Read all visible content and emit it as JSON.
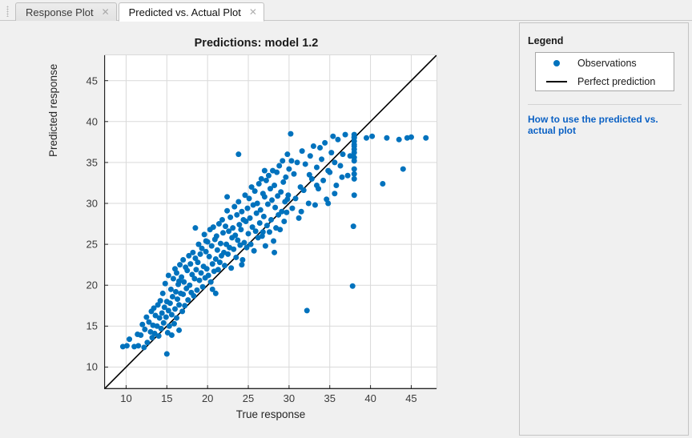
{
  "tabs": [
    {
      "label": "Response Plot",
      "close": "✕",
      "active": false
    },
    {
      "label": "Predicted vs. Actual Plot",
      "close": "✕",
      "active": true
    }
  ],
  "grip_icon": "drag-grip-icon",
  "panel": {
    "heading": "Legend",
    "legend_items": [
      {
        "label": "Observations",
        "marker": "dot",
        "color": "#0072BD"
      },
      {
        "label": "Perfect prediction",
        "marker": "line",
        "color": "#000000"
      }
    ],
    "help_link": "How to use the predicted vs. actual plot",
    "link_color": "#0b61c4"
  },
  "chart_data": {
    "type": "scatter",
    "title": "Predictions: model 1.2",
    "xlabel": "True response",
    "ylabel": "Predicted response",
    "xlim": [
      7.3,
      48.2
    ],
    "ylim": [
      7.3,
      48.2
    ],
    "xticks": [
      10,
      15,
      20,
      25,
      30,
      35,
      40,
      45
    ],
    "yticks": [
      10,
      15,
      20,
      25,
      30,
      35,
      40,
      45
    ],
    "grid": true,
    "legend_position": "outside-right",
    "marker_color": "#0072BD",
    "marker_size": 7,
    "reference_line": {
      "name": "Perfect prediction",
      "color": "#000000",
      "x": [
        7.3,
        48.2
      ],
      "y": [
        7.3,
        48.2
      ]
    },
    "series": [
      {
        "name": "Observations",
        "x": [
          9.6,
          10.1,
          10.4,
          11.0,
          11.4,
          11.5,
          11.8,
          12.0,
          12.2,
          12.3,
          12.5,
          12.6,
          12.8,
          13.0,
          13.1,
          13.2,
          13.3,
          13.4,
          13.5,
          13.6,
          13.8,
          13.9,
          14.0,
          14.1,
          14.2,
          14.3,
          14.4,
          14.5,
          14.6,
          14.7,
          14.8,
          14.9,
          15.0,
          15.0,
          15.1,
          15.2,
          15.2,
          15.3,
          15.4,
          15.5,
          15.6,
          15.6,
          15.7,
          15.8,
          15.9,
          16.0,
          16.0,
          16.1,
          16.2,
          16.2,
          16.3,
          16.4,
          16.5,
          16.5,
          16.6,
          16.7,
          16.8,
          16.9,
          17.0,
          17.0,
          17.1,
          17.2,
          17.3,
          17.4,
          17.5,
          17.6,
          17.7,
          17.8,
          17.9,
          18.0,
          18.1,
          18.2,
          18.3,
          18.4,
          18.5,
          18.6,
          18.7,
          18.8,
          18.9,
          19.0,
          19.1,
          19.2,
          19.3,
          19.4,
          19.5,
          19.6,
          19.7,
          19.8,
          19.9,
          20.0,
          20.1,
          20.2,
          20.3,
          20.4,
          20.5,
          20.6,
          20.7,
          20.8,
          20.9,
          21.0,
          21.1,
          21.2,
          21.3,
          21.4,
          21.5,
          21.6,
          21.7,
          21.8,
          21.9,
          22.0,
          22.1,
          22.2,
          22.3,
          22.4,
          22.5,
          22.6,
          22.7,
          22.8,
          22.9,
          23.0,
          23.1,
          23.2,
          23.3,
          23.4,
          23.5,
          23.6,
          23.7,
          23.8,
          23.9,
          24.0,
          24.1,
          24.2,
          24.3,
          24.4,
          24.5,
          24.6,
          24.7,
          24.8,
          24.9,
          25.0,
          25.1,
          25.2,
          25.3,
          25.4,
          25.5,
          25.6,
          25.7,
          25.8,
          25.9,
          26.0,
          26.1,
          26.2,
          26.3,
          26.4,
          26.5,
          26.6,
          26.7,
          26.8,
          26.9,
          27.0,
          27.1,
          27.2,
          27.3,
          27.4,
          27.5,
          27.6,
          27.7,
          27.8,
          27.9,
          28.0,
          28.1,
          28.2,
          28.3,
          28.4,
          28.5,
          28.6,
          28.7,
          28.8,
          28.9,
          29.0,
          29.1,
          29.2,
          29.3,
          29.4,
          29.5,
          29.6,
          29.7,
          29.8,
          29.9,
          30.0,
          30.2,
          30.4,
          30.6,
          30.8,
          31.0,
          31.2,
          31.4,
          31.6,
          31.8,
          32.0,
          32.2,
          32.4,
          32.6,
          32.8,
          33.0,
          33.2,
          33.4,
          33.6,
          33.8,
          34.0,
          34.2,
          34.4,
          34.6,
          34.8,
          35.0,
          35.2,
          35.4,
          35.6,
          35.8,
          36.0,
          36.3,
          36.6,
          36.9,
          37.2,
          37.5,
          37.8,
          38.0,
          38.0,
          38.0,
          38.0,
          38.0,
          38.0,
          38.0,
          38.0,
          38.0,
          38.0,
          38.0,
          38.0,
          38.0,
          38.0,
          39.5,
          40.2,
          41.5,
          42.0,
          43.5,
          44.0,
          44.5,
          45.0,
          46.8,
          23.8,
          27.0,
          30.3,
          32.5,
          37.9,
          21.0,
          18.5,
          29.8,
          33.4,
          35.6,
          16.5,
          19.8,
          24.2,
          26.8,
          31.5,
          34.8,
          36.5,
          28.2,
          22.4,
          20.6
        ],
        "y": [
          12.5,
          12.6,
          13.4,
          12.5,
          14.0,
          12.6,
          13.9,
          15.2,
          12.4,
          14.6,
          16.1,
          13.0,
          15.5,
          14.3,
          16.8,
          13.6,
          15.1,
          17.2,
          14.1,
          16.3,
          15.0,
          17.6,
          13.8,
          16.0,
          18.1,
          14.7,
          16.6,
          19.0,
          15.4,
          17.3,
          20.2,
          16.1,
          11.6,
          18.0,
          14.2,
          16.9,
          21.2,
          15.0,
          17.8,
          19.5,
          13.9,
          16.4,
          18.6,
          20.8,
          15.3,
          17.1,
          22.0,
          19.2,
          16.0,
          21.5,
          18.3,
          20.1,
          14.5,
          17.6,
          22.5,
          19.0,
          21.0,
          16.8,
          18.9,
          23.1,
          20.4,
          17.5,
          22.2,
          19.6,
          21.8,
          18.2,
          23.6,
          20.0,
          22.6,
          19.1,
          21.3,
          24.0,
          18.7,
          20.8,
          23.3,
          21.9,
          19.4,
          22.8,
          25.0,
          20.6,
          23.8,
          21.5,
          24.5,
          19.8,
          22.3,
          26.2,
          20.9,
          24.1,
          22.0,
          25.3,
          21.2,
          23.5,
          26.8,
          20.4,
          24.8,
          22.6,
          27.1,
          21.7,
          25.6,
          23.2,
          26.0,
          24.3,
          21.9,
          27.5,
          22.8,
          25.1,
          23.6,
          28.0,
          26.4,
          24.0,
          22.4,
          27.2,
          25.0,
          29.1,
          23.8,
          26.6,
          24.6,
          28.3,
          22.1,
          25.8,
          27.0,
          24.4,
          29.6,
          26.1,
          23.4,
          28.6,
          25.5,
          30.2,
          27.4,
          24.9,
          26.8,
          29.0,
          23.1,
          28.0,
          25.2,
          31.0,
          27.8,
          24.6,
          29.4,
          26.3,
          30.6,
          28.2,
          25.0,
          32.0,
          27.1,
          29.8,
          24.2,
          31.5,
          26.6,
          28.8,
          30.0,
          25.8,
          32.4,
          27.6,
          29.2,
          33.0,
          26.0,
          31.2,
          28.4,
          30.8,
          24.8,
          32.8,
          27.3,
          29.9,
          33.4,
          26.5,
          31.8,
          28.0,
          30.4,
          34.0,
          25.4,
          32.2,
          29.5,
          27.0,
          33.8,
          30.9,
          28.6,
          34.6,
          26.8,
          31.4,
          29.0,
          35.2,
          32.6,
          27.8,
          30.2,
          33.2,
          28.9,
          36.0,
          31.0,
          34.2,
          38.5,
          29.4,
          33.6,
          30.6,
          35.0,
          28.2,
          32.0,
          36.4,
          31.6,
          34.8,
          16.9,
          30.0,
          35.8,
          33.0,
          37.0,
          29.8,
          34.4,
          31.8,
          36.8,
          35.4,
          32.8,
          37.4,
          30.5,
          34.0,
          33.8,
          36.2,
          38.2,
          35.0,
          32.2,
          37.8,
          34.6,
          36.0,
          38.4,
          33.4,
          35.8,
          19.9,
          38.0,
          37.2,
          35.2,
          33.0,
          36.6,
          38.4,
          34.2,
          37.6,
          36.2,
          31.0,
          38.1,
          35.6,
          33.6,
          37.0,
          38.0,
          38.2,
          32.4,
          38.0,
          37.8,
          34.2,
          38.0,
          38.1,
          38.0,
          36.0,
          34.0,
          35.2,
          33.5,
          27.2,
          19.0,
          27.0,
          30.5,
          32.2,
          31.2,
          20.5,
          25.4,
          22.5,
          26.5,
          29.0,
          30.0,
          33.2,
          24.0,
          30.8,
          19.5
        ]
      }
    ]
  }
}
